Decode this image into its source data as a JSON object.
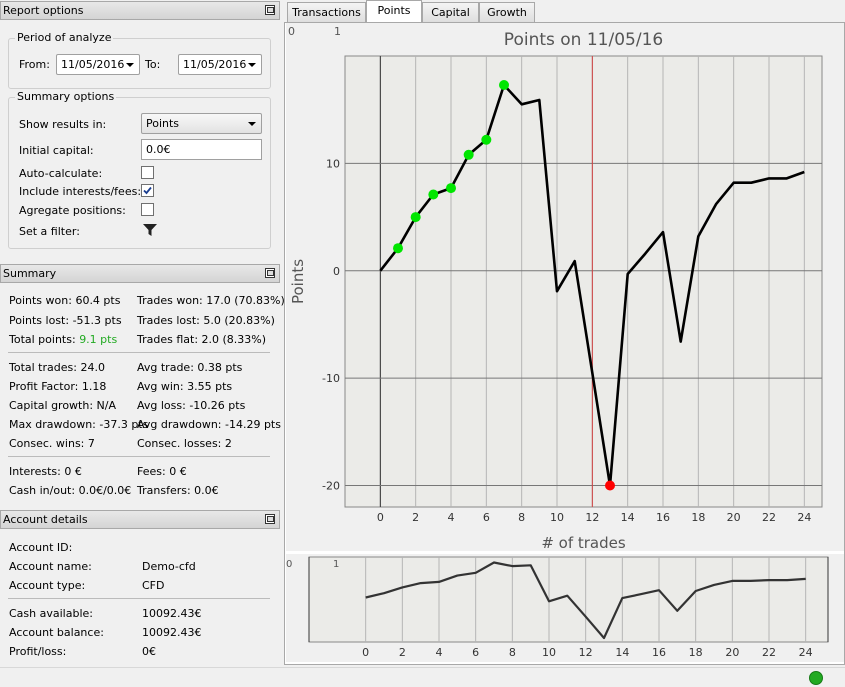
{
  "report_options": {
    "title": "Report options",
    "period": {
      "title": "Period of analyze",
      "from_label": "From:",
      "from_value": "11/05/2016",
      "to_label": "To:",
      "to_value": "11/05/2016"
    },
    "summary_options": {
      "title": "Summary options",
      "show_results_label": "Show results in:",
      "show_results_value": "Points",
      "initial_capital_label": "Initial capital:",
      "initial_capital_value": "0.0€",
      "auto_calculate_label": "Auto-calculate:",
      "auto_calculate_checked": false,
      "include_interests_label": "Include interests/fees:",
      "include_interests_checked": true,
      "aggregate_label": "Agregate positions:",
      "aggregate_checked": false,
      "filter_label": "Set a filter:"
    }
  },
  "summary": {
    "title": "Summary",
    "points_won": "Points won: 60.4 pts",
    "trades_won": "Trades won: 17.0 (70.83%)",
    "points_lost": "Points lost: -51.3 pts",
    "trades_lost": "Trades lost: 5.0 (20.83%)",
    "total_points_label": "Total points:",
    "total_points_value": "9.1 pts",
    "trades_flat": "Trades flat: 2.0 (8.33%)",
    "total_trades": "Total trades: 24.0",
    "avg_trade": "Avg trade: 0.38 pts",
    "profit_factor": "Profit Factor: 1.18",
    "avg_win": "Avg win: 3.55 pts",
    "capital_growth": "Capital growth: N/A",
    "avg_loss": "Avg loss: -10.26 pts",
    "max_drawdown": "Max drawdown: -37.3 pts",
    "avg_drawdown": "Avg drawdown: -14.29 pts",
    "consec_wins": "Consec. wins: 7",
    "consec_losses": "Consec. losses: 2",
    "interests": "Interests: 0 €",
    "fees": "Fees: 0 €",
    "cash_in_out": "Cash in/out: 0.0€/0.0€",
    "transfers": "Transfers: 0.0€"
  },
  "account": {
    "title": "Account details",
    "id_label": "Account ID:",
    "id_value": "",
    "name_label": "Account name:",
    "name_value": "Demo-cfd",
    "type_label": "Account type:",
    "type_value": "CFD",
    "cash_label": "Cash available:",
    "cash_value": "10092.43€",
    "balance_label": "Account balance:",
    "balance_value": "10092.43€",
    "pl_label": "Profit/loss:",
    "pl_value": "0€"
  },
  "tabs": [
    "Transactions",
    "Points",
    "Capital",
    "Growth"
  ],
  "active_tab": "Points",
  "colors": {
    "win_point": "#00e600",
    "loss_point": "#ff0000",
    "line": "#000000",
    "marker_line": "#d04040",
    "total_points": "#22aa22",
    "status_ok": "#22aa22"
  },
  "chart_data": {
    "type": "line",
    "title": "Points on 11/05/16",
    "xlabel": "# of trades",
    "ylabel": "Points",
    "xlim": [
      -2,
      25
    ],
    "ylim": [
      -22,
      20
    ],
    "xticks": [
      0,
      2,
      4,
      6,
      8,
      10,
      12,
      14,
      16,
      18,
      20,
      22,
      24
    ],
    "yticks": [
      -20,
      -10,
      0,
      10
    ],
    "corner_labels": [
      "0",
      "1"
    ],
    "vertical_marker_x": 12,
    "x": [
      0,
      1,
      2,
      3,
      4,
      5,
      6,
      7,
      8,
      9,
      10,
      11,
      12,
      13,
      14,
      15,
      16,
      17,
      18,
      19,
      20,
      21,
      22,
      23,
      24
    ],
    "y": [
      0,
      2.1,
      5.0,
      7.1,
      7.7,
      10.8,
      12.2,
      17.3,
      15.5,
      15.9,
      -1.9,
      0.9,
      -9.5,
      -20.0,
      -0.3,
      1.6,
      3.6,
      -6.6,
      3.2,
      6.2,
      8.2,
      8.2,
      8.6,
      8.6,
      9.2
    ],
    "highlight_points": [
      {
        "x": 1,
        "kind": "win"
      },
      {
        "x": 2,
        "kind": "win"
      },
      {
        "x": 3,
        "kind": "win"
      },
      {
        "x": 4,
        "kind": "win"
      },
      {
        "x": 5,
        "kind": "win"
      },
      {
        "x": 6,
        "kind": "win"
      },
      {
        "x": 7,
        "kind": "win"
      },
      {
        "x": 13,
        "kind": "loss"
      }
    ],
    "overview": {
      "xticks": [
        0,
        2,
        4,
        6,
        8,
        10,
        12,
        14,
        16,
        18,
        20,
        22,
        24
      ],
      "corner_labels": [
        "0",
        "1"
      ]
    }
  }
}
